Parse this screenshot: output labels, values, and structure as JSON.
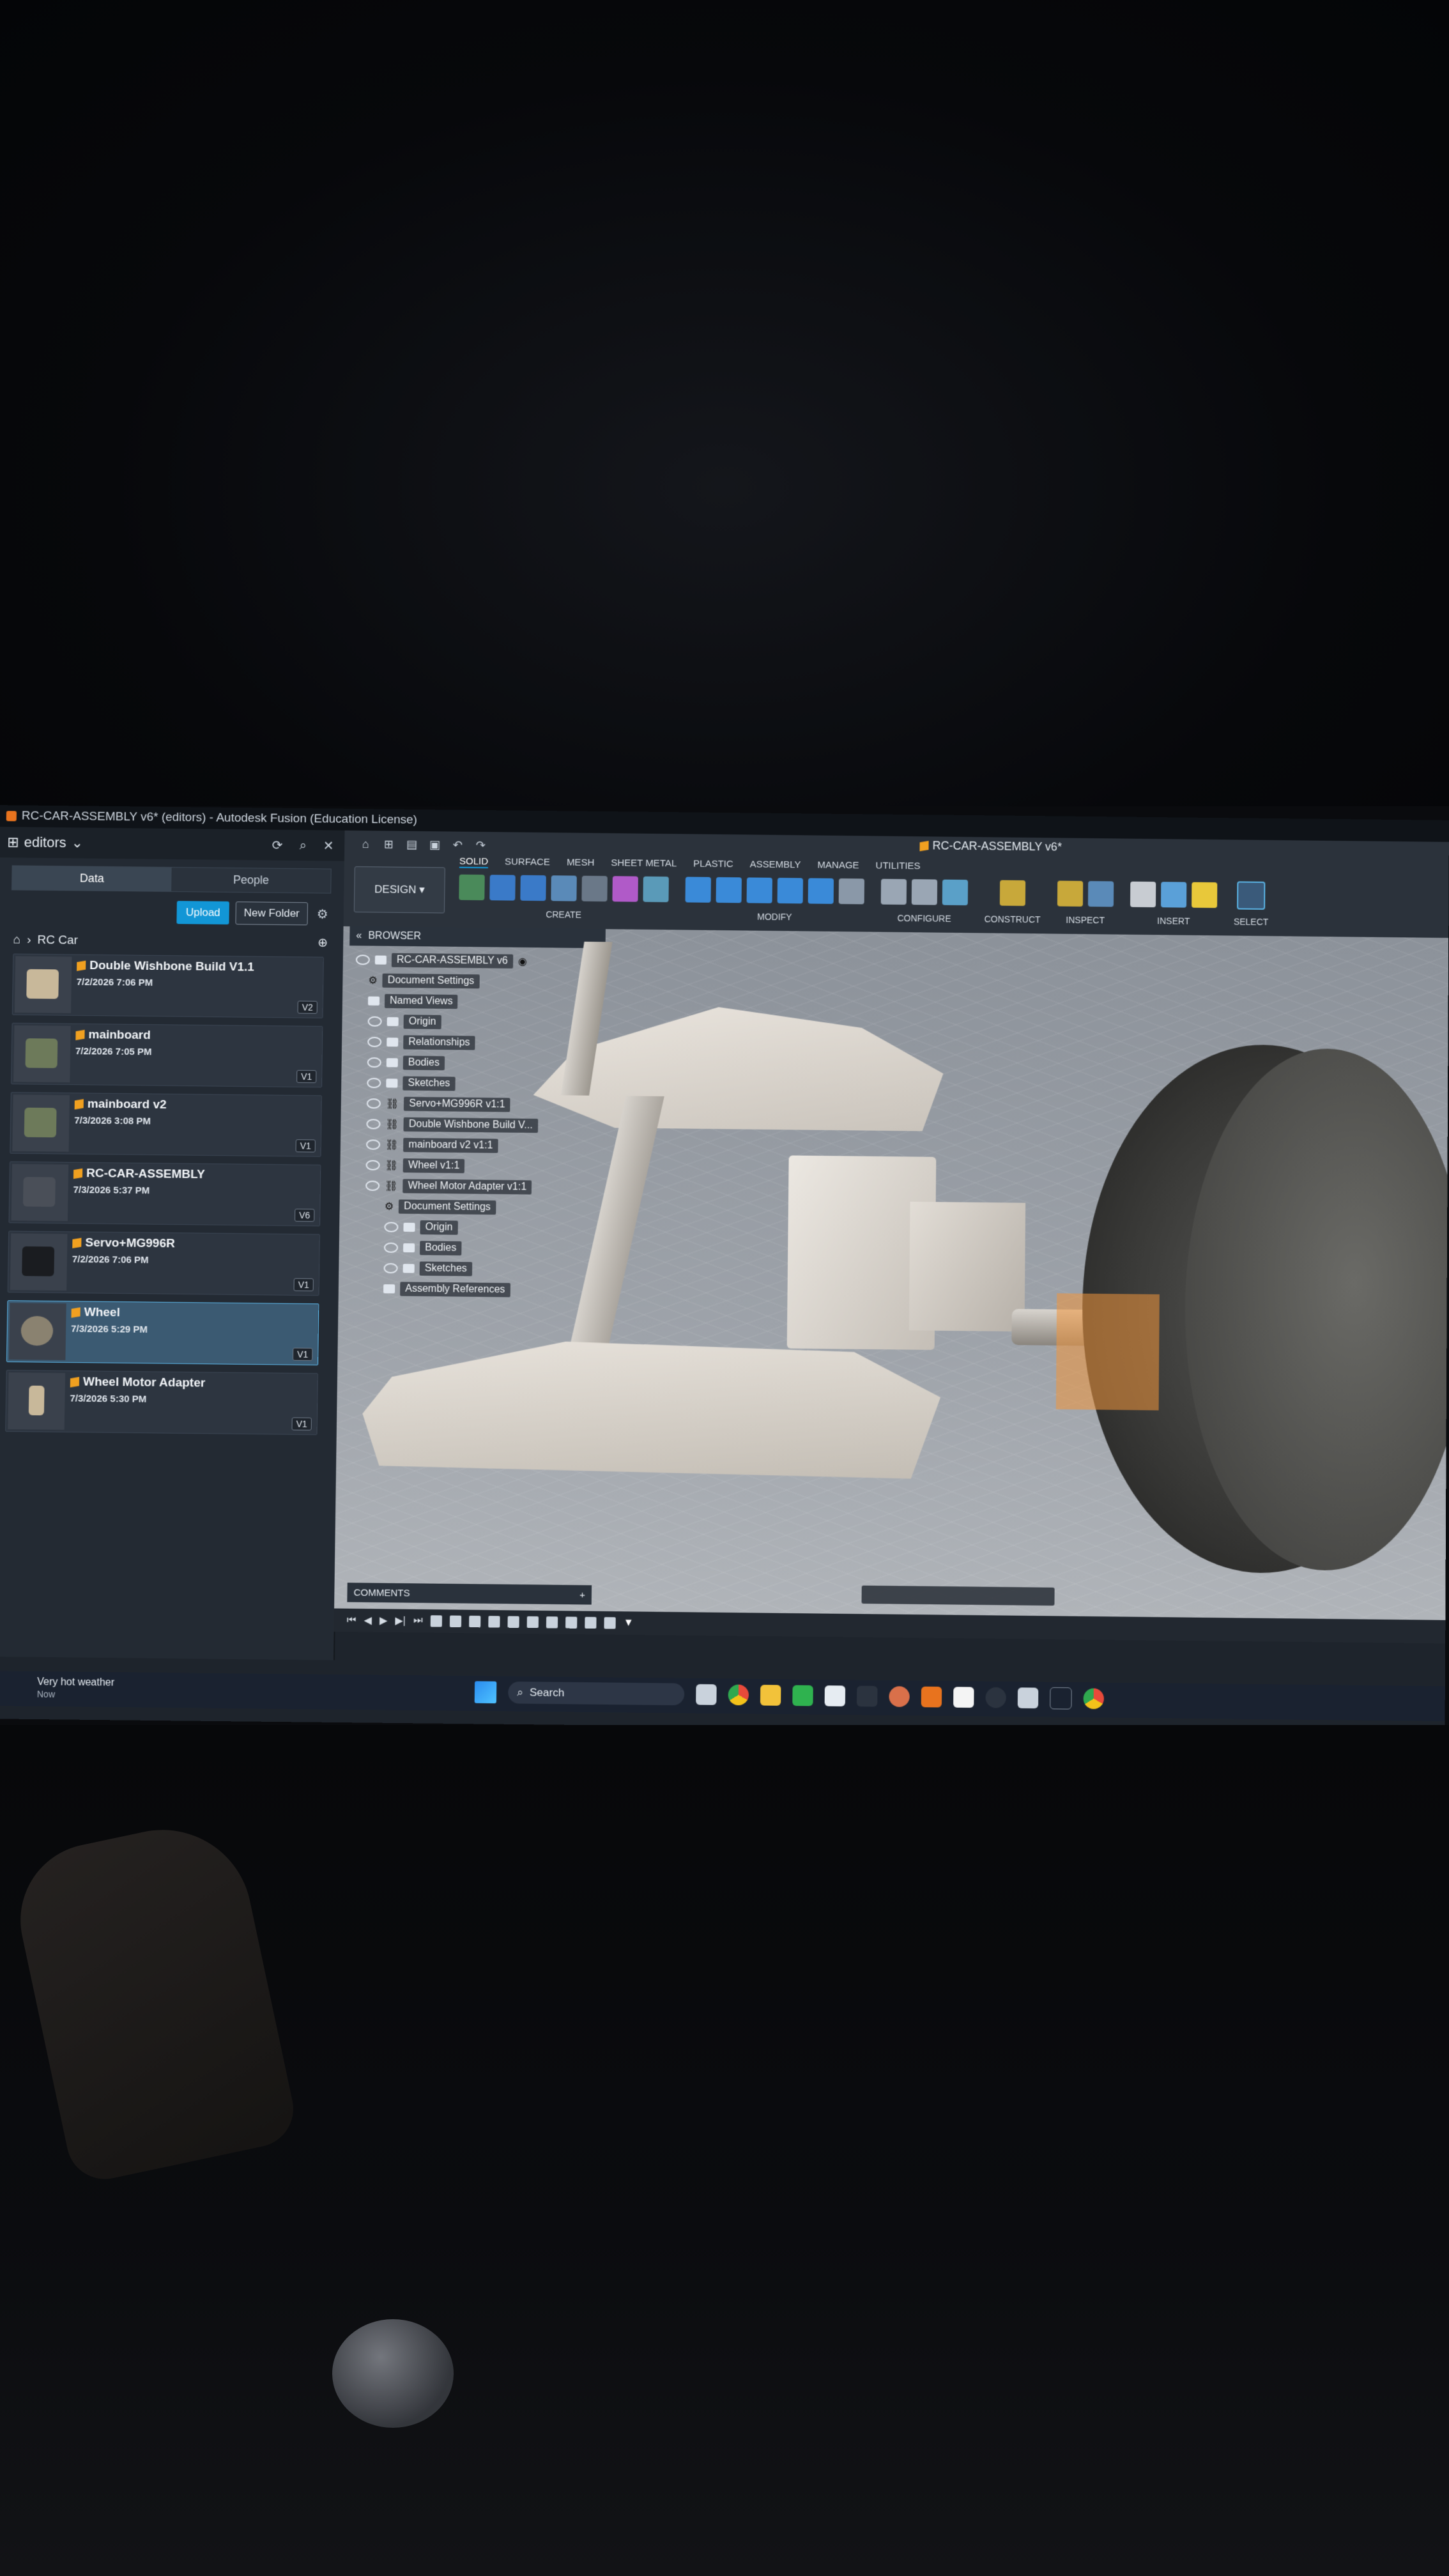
{
  "window": {
    "title": "RC-CAR-ASSEMBLY v6* (editors) - Autodesk Fusion (Education License)"
  },
  "data_panel": {
    "team": "editors",
    "tabs": [
      "Data",
      "People"
    ],
    "upload_label": "Upload",
    "new_folder_label": "New Folder",
    "breadcrumb": "RC Car",
    "items": [
      {
        "name": "Double Wishbone Build V1.1",
        "date": "7/2/2026 7:06 PM",
        "version": "V2",
        "thumb_color": "#c8b89a"
      },
      {
        "name": "mainboard",
        "date": "7/2/2026 7:05 PM",
        "version": "V1",
        "thumb_color": "#6d7a5a"
      },
      {
        "name": "mainboard v2",
        "date": "7/3/2026 3:08 PM",
        "version": "V1",
        "thumb_color": "#6d7a5a"
      },
      {
        "name": "RC-CAR-ASSEMBLY",
        "date": "7/3/2026 5:37 PM",
        "version": "V6",
        "thumb_color": "#4a4f58"
      },
      {
        "name": "Servo+MG996R",
        "date": "7/2/2026 7:06 PM",
        "version": "V1",
        "thumb_color": "#1a1c20"
      },
      {
        "name": "Wheel",
        "date": "7/3/2026 5:29 PM",
        "version": "V1",
        "thumb_color": "#8a8270"
      },
      {
        "name": "Wheel Motor Adapter",
        "date": "7/3/2026 5:30 PM",
        "version": "V1",
        "thumb_color": "#c8b89a"
      }
    ]
  },
  "toolbar": {
    "doc_tab": "RC-CAR-ASSEMBLY v6*",
    "workspace": "DESIGN",
    "ribbon_tabs": [
      "SOLID",
      "SURFACE",
      "MESH",
      "SHEET METAL",
      "PLASTIC",
      "ASSEMBLY",
      "MANAGE",
      "UTILITIES"
    ],
    "groups": [
      "CREATE",
      "MODIFY",
      "CONFIGURE",
      "CONSTRUCT",
      "INSPECT",
      "INSERT",
      "SELECT"
    ]
  },
  "browser": {
    "header": "BROWSER",
    "root": "RC-CAR-ASSEMBLY v6",
    "nodes": [
      "Document Settings",
      "Named Views",
      "Origin",
      "Relationships",
      "Bodies",
      "Sketches",
      "Servo+MG996R v1:1",
      "Double Wishbone Build V...",
      "mainboard v2 v1:1",
      "Wheel v1:1",
      "Wheel Motor Adapter v1:1",
      "Document Settings",
      "Origin",
      "Bodies",
      "Sketches",
      "Assembly References"
    ]
  },
  "comments_label": "COMMENTS",
  "taskbar": {
    "weather_title": "Very hot weather",
    "weather_sub": "Now",
    "search_label": "Search"
  },
  "colors": {
    "accent": "#1296d6",
    "selected": "#3b5a72",
    "fusion_orange": "#f0a020"
  }
}
